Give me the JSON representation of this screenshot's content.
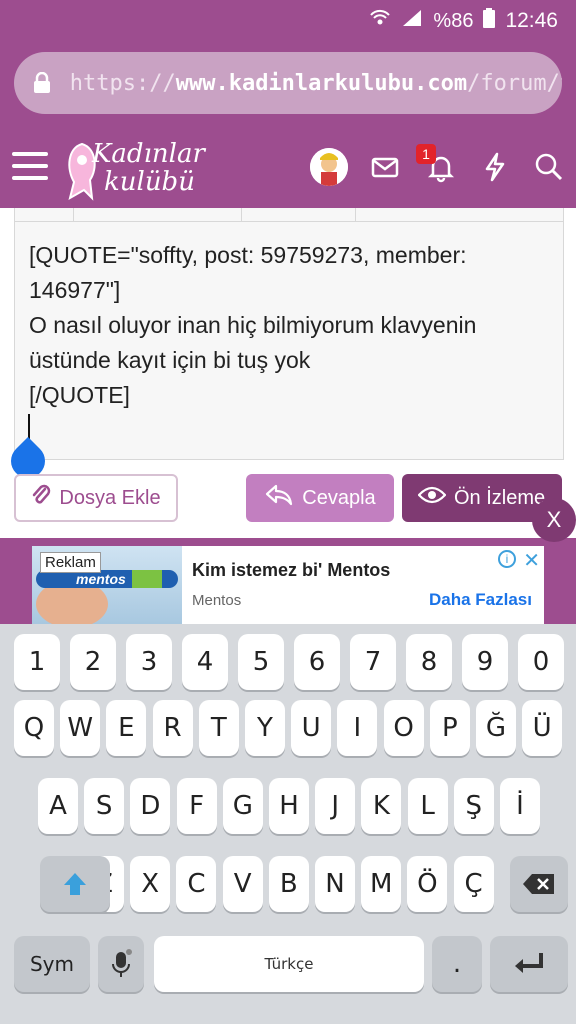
{
  "status_bar": {
    "battery": "%86",
    "time": "12:46"
  },
  "browser": {
    "url_scheme": "https://",
    "url_host": "www.kadinlarkulubu.com",
    "url_path": "/forum/thr"
  },
  "site": {
    "logo_line1": "Kadınlar",
    "logo_line2": "kulübü",
    "notification_count": "1"
  },
  "editor": {
    "text": "[QUOTE=\"soffty, post: 59759273, member:\n146977\"]\nO nasıl oluyor inan hiç bilmiyorum klavyenin\nüstünde kayıt için bi tuş yok\n[/QUOTE]"
  },
  "actions": {
    "attach_label": "Dosya Ekle",
    "reply_label": "Cevapla",
    "preview_label": "Ön İzleme",
    "close_label": "X"
  },
  "ad": {
    "label": "Reklam",
    "title": "Kim istemez bi' Mentos",
    "brand": "Mentos",
    "cta": "Daha Fazlası",
    "image_text": "mentos"
  },
  "keyboard": {
    "row_numbers": [
      "1",
      "2",
      "3",
      "4",
      "5",
      "6",
      "7",
      "8",
      "9",
      "0"
    ],
    "row_top": [
      "Q",
      "W",
      "E",
      "R",
      "T",
      "Y",
      "U",
      "I",
      "O",
      "P",
      "Ğ",
      "Ü"
    ],
    "row_home": [
      "A",
      "S",
      "D",
      "F",
      "G",
      "H",
      "J",
      "K",
      "L",
      "Ş",
      "İ"
    ],
    "row_bottom": [
      "Z",
      "X",
      "C",
      "V",
      "B",
      "N",
      "M",
      "Ö",
      "Ç"
    ],
    "sym_label": "Sym",
    "space_label": "Türkçe",
    "period_label": "."
  },
  "colors": {
    "brand": "#9d4d8f",
    "brand_dark": "#7f3a72",
    "reply": "#c27fc0",
    "cursor_handle": "#1a73e8"
  }
}
